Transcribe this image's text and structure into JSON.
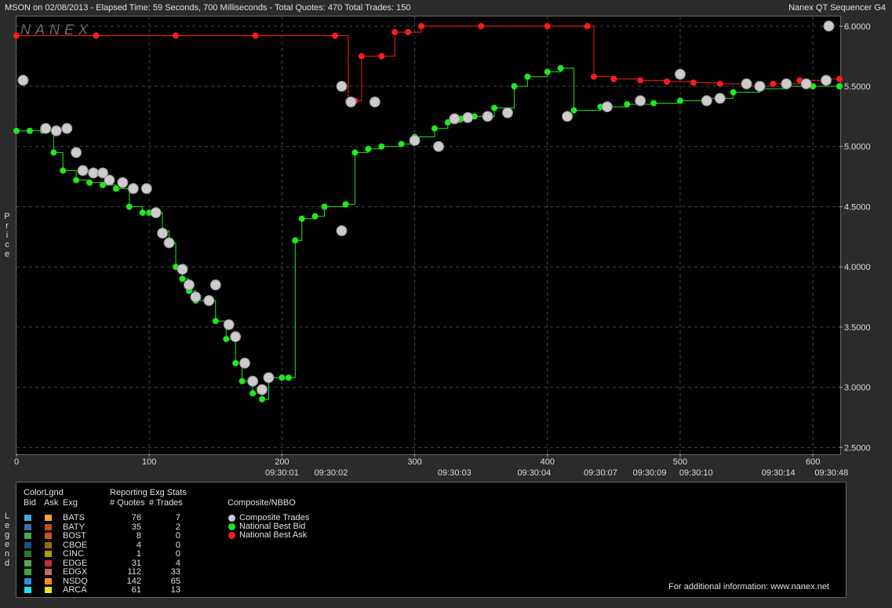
{
  "header": {
    "title": "MSON on 02/08/2013  -  Elapsed Time: 59 Seconds, 700 Milliseconds  -  Total Quotes: 470  Total Trades: 150",
    "brand": "Nanex QT Sequencer G4",
    "watermark": "NANEX",
    "y_label": "Price"
  },
  "chart_data": {
    "type": "line",
    "x_range": [
      0,
      620
    ],
    "y_range": [
      2.45,
      6.08
    ],
    "x_ticks": [
      0,
      100,
      200,
      300,
      400,
      500,
      600
    ],
    "y_ticks": [
      "2.5000",
      "3.0000",
      "3.5000",
      "4.0000",
      "4.5000",
      "5.0000",
      "5.5000",
      "6.0000"
    ],
    "time_labels": [
      {
        "x": 200,
        "label": "09:30:01"
      },
      {
        "x": 237,
        "label": "09:30:02"
      },
      {
        "x": 330,
        "label": "09:30:03"
      },
      {
        "x": 390,
        "label": "09:30:04"
      },
      {
        "x": 440,
        "label": "09:30:07"
      },
      {
        "x": 477,
        "label": "09:30:09"
      },
      {
        "x": 512,
        "label": "09:30:10"
      },
      {
        "x": 574,
        "label": "09:30:14"
      },
      {
        "x": 614,
        "label": "09:30:48"
      }
    ],
    "series": [
      {
        "name": "National Best Bid",
        "color": "#1ee81e",
        "points": [
          [
            0,
            5.13
          ],
          [
            10,
            5.13
          ],
          [
            20,
            5.13
          ],
          [
            28,
            4.95
          ],
          [
            35,
            4.8
          ],
          [
            45,
            4.72
          ],
          [
            55,
            4.7
          ],
          [
            65,
            4.68
          ],
          [
            75,
            4.65
          ],
          [
            85,
            4.5
          ],
          [
            95,
            4.45
          ],
          [
            100,
            4.45
          ],
          [
            110,
            4.3
          ],
          [
            115,
            4.2
          ],
          [
            120,
            4.0
          ],
          [
            125,
            3.9
          ],
          [
            130,
            3.8
          ],
          [
            135,
            3.72
          ],
          [
            145,
            3.72
          ],
          [
            150,
            3.55
          ],
          [
            158,
            3.4
          ],
          [
            165,
            3.2
          ],
          [
            170,
            3.05
          ],
          [
            178,
            2.95
          ],
          [
            185,
            2.9
          ],
          [
            190,
            3.08
          ],
          [
            200,
            3.08
          ],
          [
            205,
            3.08
          ],
          [
            210,
            4.22
          ],
          [
            215,
            4.4
          ],
          [
            225,
            4.42
          ],
          [
            232,
            4.5
          ],
          [
            248,
            4.52
          ],
          [
            255,
            4.95
          ],
          [
            265,
            4.98
          ],
          [
            275,
            5.0
          ],
          [
            290,
            5.02
          ],
          [
            300,
            5.08
          ],
          [
            315,
            5.15
          ],
          [
            325,
            5.2
          ],
          [
            335,
            5.23
          ],
          [
            345,
            5.25
          ],
          [
            360,
            5.32
          ],
          [
            375,
            5.5
          ],
          [
            385,
            5.58
          ],
          [
            400,
            5.62
          ],
          [
            410,
            5.65
          ],
          [
            420,
            5.3
          ],
          [
            440,
            5.33
          ],
          [
            460,
            5.35
          ],
          [
            480,
            5.36
          ],
          [
            500,
            5.38
          ],
          [
            520,
            5.4
          ],
          [
            540,
            5.45
          ],
          [
            560,
            5.48
          ],
          [
            580,
            5.5
          ],
          [
            600,
            5.5
          ],
          [
            620,
            5.5
          ]
        ]
      },
      {
        "name": "National Best Ask",
        "color": "#ff1a1a",
        "points": [
          [
            0,
            5.92
          ],
          [
            60,
            5.92
          ],
          [
            120,
            5.92
          ],
          [
            180,
            5.92
          ],
          [
            240,
            5.92
          ],
          [
            250,
            5.38
          ],
          [
            255,
            5.38
          ],
          [
            260,
            5.75
          ],
          [
            275,
            5.75
          ],
          [
            285,
            5.95
          ],
          [
            295,
            5.95
          ],
          [
            305,
            6.0
          ],
          [
            350,
            6.0
          ],
          [
            400,
            6.0
          ],
          [
            430,
            6.0
          ],
          [
            435,
            5.58
          ],
          [
            450,
            5.56
          ],
          [
            470,
            5.55
          ],
          [
            490,
            5.54
          ],
          [
            510,
            5.53
          ],
          [
            530,
            5.52
          ],
          [
            550,
            5.5
          ],
          [
            570,
            5.52
          ],
          [
            590,
            5.55
          ],
          [
            610,
            5.56
          ],
          [
            620,
            5.56
          ]
        ]
      },
      {
        "name": "Composite Trades",
        "color": "#cccccc",
        "points": [
          [
            5,
            5.55
          ],
          [
            22,
            5.15
          ],
          [
            30,
            5.13
          ],
          [
            38,
            5.15
          ],
          [
            45,
            4.95
          ],
          [
            50,
            4.8
          ],
          [
            58,
            4.78
          ],
          [
            65,
            4.78
          ],
          [
            70,
            4.72
          ],
          [
            80,
            4.7
          ],
          [
            88,
            4.65
          ],
          [
            98,
            4.65
          ],
          [
            105,
            4.45
          ],
          [
            110,
            4.28
          ],
          [
            115,
            4.2
          ],
          [
            125,
            3.98
          ],
          [
            130,
            3.85
          ],
          [
            135,
            3.75
          ],
          [
            145,
            3.72
          ],
          [
            150,
            3.85
          ],
          [
            160,
            3.52
          ],
          [
            165,
            3.42
          ],
          [
            172,
            3.2
          ],
          [
            178,
            3.05
          ],
          [
            185,
            2.98
          ],
          [
            190,
            3.08
          ],
          [
            245,
            5.5
          ],
          [
            252,
            5.37
          ],
          [
            270,
            5.37
          ],
          [
            245,
            4.3
          ],
          [
            300,
            5.05
          ],
          [
            318,
            5.0
          ],
          [
            330,
            5.23
          ],
          [
            340,
            5.24
          ],
          [
            355,
            5.25
          ],
          [
            370,
            5.28
          ],
          [
            415,
            5.25
          ],
          [
            445,
            5.33
          ],
          [
            470,
            5.38
          ],
          [
            500,
            5.6
          ],
          [
            520,
            5.38
          ],
          [
            530,
            5.4
          ],
          [
            550,
            5.52
          ],
          [
            560,
            5.5
          ],
          [
            580,
            5.52
          ],
          [
            595,
            5.52
          ],
          [
            610,
            5.55
          ],
          [
            612,
            6.0
          ]
        ]
      }
    ]
  },
  "legend": {
    "label": "Legend",
    "color_legend": "ColorLgnd",
    "bid_header": "Bid",
    "ask_header": "Ask",
    "exg_header": "Exg",
    "stats_title": "Reporting Exg Stats",
    "quotes_header": "# Quotes",
    "trades_header": "# Trades",
    "composite_title": "Composite/NBBO",
    "rows": [
      {
        "exg": "BATS",
        "quotes": "76",
        "trades": "7",
        "bid": "#4fa3d9",
        "ask": "#f0a040"
      },
      {
        "exg": "BATY",
        "quotes": "35",
        "trades": "2",
        "bid": "#3b6fa8",
        "ask": "#c05020"
      },
      {
        "exg": "BOST",
        "quotes": "8",
        "trades": "0",
        "bid": "#4caa4c",
        "ask": "#c85a20"
      },
      {
        "exg": "CBOE",
        "quotes": "4",
        "trades": "0",
        "bid": "#1f4f8a",
        "ask": "#9a6a10"
      },
      {
        "exg": "CINC",
        "quotes": "1",
        "trades": "0",
        "bid": "#2a7a2a",
        "ask": "#b0a000"
      },
      {
        "exg": "EDGE",
        "quotes": "31",
        "trades": "4",
        "bid": "#5aa05a",
        "ask": "#c03030"
      },
      {
        "exg": "EDGX",
        "quotes": "112",
        "trades": "33",
        "bid": "#3aa83a",
        "ask": "#c07060"
      },
      {
        "exg": "NSDQ",
        "quotes": "142",
        "trades": "65",
        "bid": "#2f8fe0",
        "ask": "#f09020"
      },
      {
        "exg": "ARCA",
        "quotes": "61",
        "trades": "13",
        "bid": "#20e0f0",
        "ask": "#f0e020"
      }
    ],
    "composite_items": [
      {
        "label": "Composite Trades",
        "color": "#cccccc"
      },
      {
        "label": "National Best Bid",
        "color": "#1ee81e"
      },
      {
        "label": "National Best Ask",
        "color": "#ff1a1a"
      }
    ],
    "footer": "For additional information: www.nanex.net"
  }
}
